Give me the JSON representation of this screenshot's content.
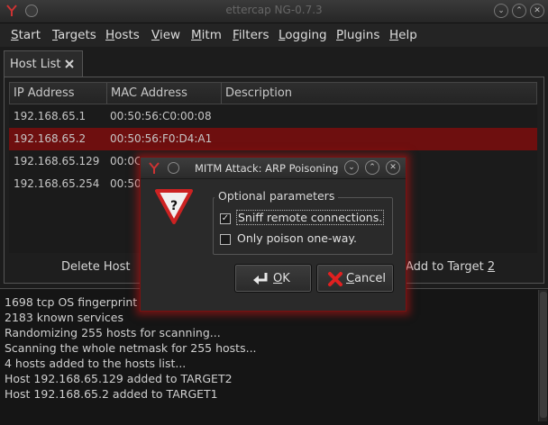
{
  "window": {
    "title": "ettercap NG-0.7.3"
  },
  "menu": [
    {
      "pre": "",
      "u": "S",
      "post": "tart"
    },
    {
      "pre": "",
      "u": "T",
      "post": "argets"
    },
    {
      "pre": "",
      "u": "H",
      "post": "osts"
    },
    {
      "pre": "",
      "u": "V",
      "post": "iew"
    },
    {
      "pre": "",
      "u": "M",
      "post": "itm"
    },
    {
      "pre": "",
      "u": "F",
      "post": "ilters"
    },
    {
      "pre": "",
      "u": "L",
      "post": "ogging"
    },
    {
      "pre": "",
      "u": "P",
      "post": "lugins"
    },
    {
      "pre": "",
      "u": "H",
      "post": "elp"
    }
  ],
  "tab": {
    "label": "Host List",
    "close_icon": "close-icon"
  },
  "table": {
    "headers": [
      "IP Address",
      "MAC Address",
      "Description"
    ],
    "rows": [
      {
        "ip": "192.168.65.1",
        "mac": "00:50:56:C0:00:08",
        "desc": ""
      },
      {
        "ip": "192.168.65.2",
        "mac": "00:50:56:F0:D4:A1",
        "desc": ""
      },
      {
        "ip": "192.168.65.129",
        "mac": "00:0C",
        "desc": ""
      },
      {
        "ip": "192.168.65.254",
        "mac": "00:50",
        "desc": ""
      }
    ],
    "selected_index": 1,
    "selected_color": "#6e0f0f"
  },
  "buttons": {
    "delete_host": "Delete Host",
    "add_target2_pre": "Add to Target ",
    "add_target2_u": "2"
  },
  "log": [
    "1698 tcp OS fingerprint",
    "2183 known services",
    "Randomizing 255 hosts for scanning...",
    "Scanning the whole netmask for 255 hosts...",
    "4 hosts added to the hosts list...",
    "Host 192.168.65.129 added to TARGET2",
    "Host 192.168.65.2 added to TARGET1"
  ],
  "dialog": {
    "title": "MITM Attack: ARP Poisoning",
    "group_title": "Optional parameters",
    "options": [
      {
        "label": "Sniff remote connections.",
        "checked": true,
        "mark": "✓"
      },
      {
        "label": "Only poison one-way.",
        "checked": false,
        "mark": ""
      }
    ],
    "ok": {
      "u": "O",
      "rest": "K",
      "icon": "enter-arrow-icon"
    },
    "cancel": {
      "u": "C",
      "rest": "ancel",
      "icon": "red-x-icon"
    },
    "warning_icon": "warning-question-icon",
    "glow_color": "#c81414"
  }
}
